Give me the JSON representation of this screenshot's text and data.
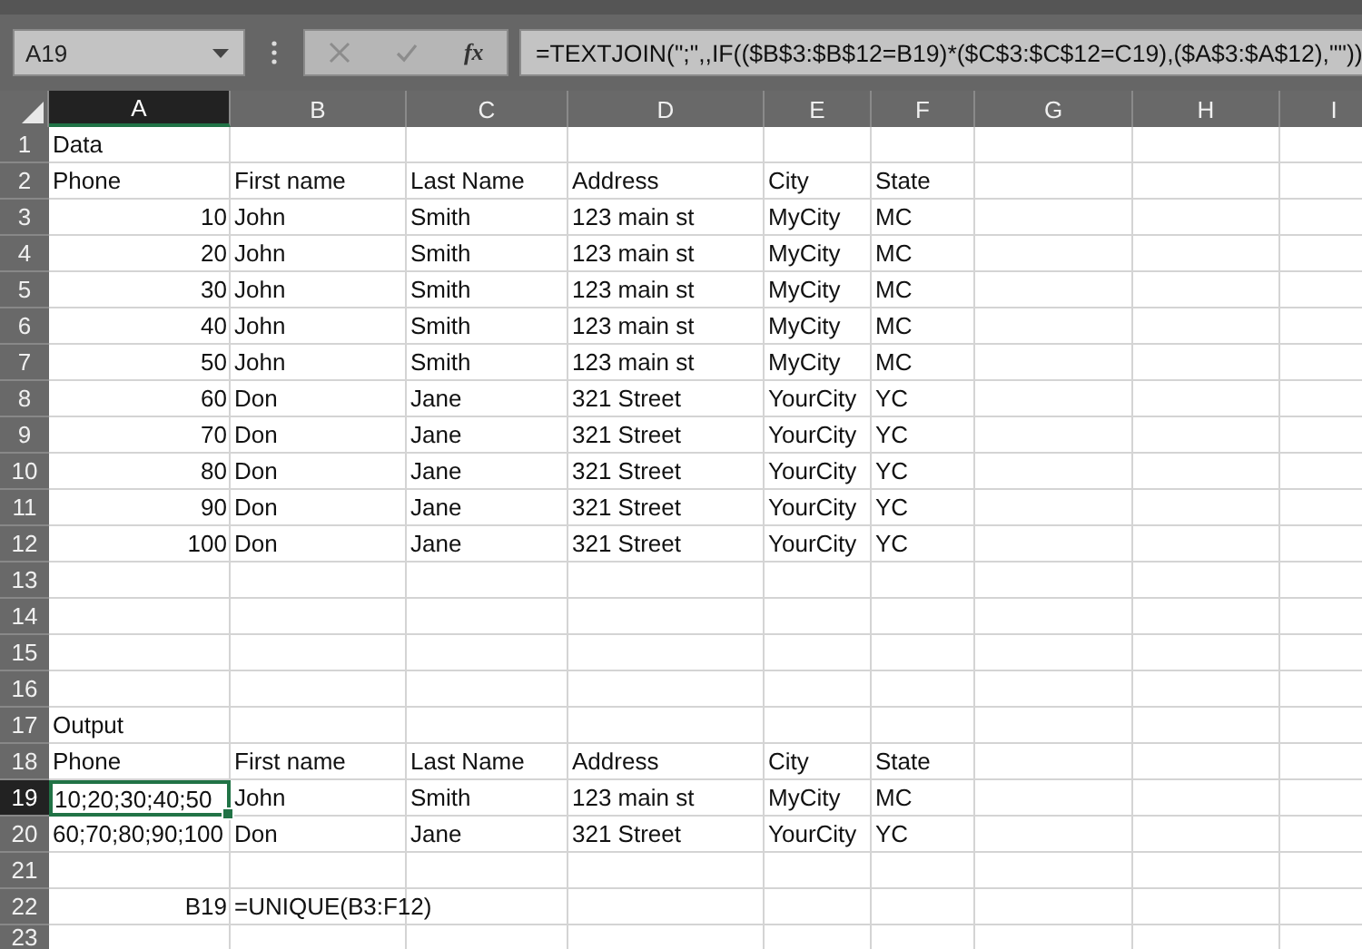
{
  "name_box": {
    "value": "A19"
  },
  "formula_bar": {
    "function_label": "fx",
    "formula": "=TEXTJOIN(\";\",,IF(($B$3:$B$12=B19)*($C$3:$C$12=C19),($A$3:$A$12),\"\"))"
  },
  "columns": [
    {
      "label": "A",
      "selected": true
    },
    {
      "label": "B",
      "selected": false
    },
    {
      "label": "C",
      "selected": false
    },
    {
      "label": "D",
      "selected": false
    },
    {
      "label": "E",
      "selected": false
    },
    {
      "label": "F",
      "selected": false
    },
    {
      "label": "G",
      "selected": false
    },
    {
      "label": "H",
      "selected": false
    },
    {
      "label": "I",
      "selected": false
    }
  ],
  "rows": [
    {
      "label": "1",
      "selected": false,
      "cells": [
        {
          "text": "Data",
          "kind": "text"
        }
      ]
    },
    {
      "label": "2",
      "selected": false,
      "cells": [
        {
          "text": "Phone",
          "kind": "text"
        },
        {
          "text": "First name",
          "kind": "text"
        },
        {
          "text": "Last Name",
          "kind": "text"
        },
        {
          "text": "Address",
          "kind": "text"
        },
        {
          "text": "City",
          "kind": "text"
        },
        {
          "text": "State",
          "kind": "text"
        }
      ]
    },
    {
      "label": "3",
      "selected": false,
      "cells": [
        {
          "text": "10",
          "kind": "number"
        },
        {
          "text": "John",
          "kind": "text"
        },
        {
          "text": "Smith",
          "kind": "text"
        },
        {
          "text": "123 main st",
          "kind": "text"
        },
        {
          "text": "MyCity",
          "kind": "text"
        },
        {
          "text": "MC",
          "kind": "text"
        }
      ]
    },
    {
      "label": "4",
      "selected": false,
      "cells": [
        {
          "text": "20",
          "kind": "number"
        },
        {
          "text": "John",
          "kind": "text"
        },
        {
          "text": "Smith",
          "kind": "text"
        },
        {
          "text": "123 main st",
          "kind": "text"
        },
        {
          "text": "MyCity",
          "kind": "text"
        },
        {
          "text": "MC",
          "kind": "text"
        }
      ]
    },
    {
      "label": "5",
      "selected": false,
      "cells": [
        {
          "text": "30",
          "kind": "number"
        },
        {
          "text": "John",
          "kind": "text"
        },
        {
          "text": "Smith",
          "kind": "text"
        },
        {
          "text": "123 main st",
          "kind": "text"
        },
        {
          "text": "MyCity",
          "kind": "text"
        },
        {
          "text": "MC",
          "kind": "text"
        }
      ]
    },
    {
      "label": "6",
      "selected": false,
      "cells": [
        {
          "text": "40",
          "kind": "number"
        },
        {
          "text": "John",
          "kind": "text"
        },
        {
          "text": "Smith",
          "kind": "text"
        },
        {
          "text": "123 main st",
          "kind": "text"
        },
        {
          "text": "MyCity",
          "kind": "text"
        },
        {
          "text": "MC",
          "kind": "text"
        }
      ]
    },
    {
      "label": "7",
      "selected": false,
      "cells": [
        {
          "text": "50",
          "kind": "number"
        },
        {
          "text": "John",
          "kind": "text"
        },
        {
          "text": "Smith",
          "kind": "text"
        },
        {
          "text": "123 main st",
          "kind": "text"
        },
        {
          "text": "MyCity",
          "kind": "text"
        },
        {
          "text": "MC",
          "kind": "text"
        }
      ]
    },
    {
      "label": "8",
      "selected": false,
      "cells": [
        {
          "text": "60",
          "kind": "number"
        },
        {
          "text": "Don",
          "kind": "text"
        },
        {
          "text": "Jane",
          "kind": "text"
        },
        {
          "text": "321 Street",
          "kind": "text"
        },
        {
          "text": "YourCity",
          "kind": "text"
        },
        {
          "text": "YC",
          "kind": "text"
        }
      ]
    },
    {
      "label": "9",
      "selected": false,
      "cells": [
        {
          "text": "70",
          "kind": "number"
        },
        {
          "text": "Don",
          "kind": "text"
        },
        {
          "text": "Jane",
          "kind": "text"
        },
        {
          "text": "321 Street",
          "kind": "text"
        },
        {
          "text": "YourCity",
          "kind": "text"
        },
        {
          "text": "YC",
          "kind": "text"
        }
      ]
    },
    {
      "label": "10",
      "selected": false,
      "cells": [
        {
          "text": "80",
          "kind": "number"
        },
        {
          "text": "Don",
          "kind": "text"
        },
        {
          "text": "Jane",
          "kind": "text"
        },
        {
          "text": "321 Street",
          "kind": "text"
        },
        {
          "text": "YourCity",
          "kind": "text"
        },
        {
          "text": "YC",
          "kind": "text"
        }
      ]
    },
    {
      "label": "11",
      "selected": false,
      "cells": [
        {
          "text": "90",
          "kind": "number"
        },
        {
          "text": "Don",
          "kind": "text"
        },
        {
          "text": "Jane",
          "kind": "text"
        },
        {
          "text": "321 Street",
          "kind": "text"
        },
        {
          "text": "YourCity",
          "kind": "text"
        },
        {
          "text": "YC",
          "kind": "text"
        }
      ]
    },
    {
      "label": "12",
      "selected": false,
      "cells": [
        {
          "text": "100",
          "kind": "number"
        },
        {
          "text": "Don",
          "kind": "text"
        },
        {
          "text": "Jane",
          "kind": "text"
        },
        {
          "text": "321 Street",
          "kind": "text"
        },
        {
          "text": "YourCity",
          "kind": "text"
        },
        {
          "text": "YC",
          "kind": "text"
        }
      ]
    },
    {
      "label": "13",
      "selected": false,
      "cells": []
    },
    {
      "label": "14",
      "selected": false,
      "cells": []
    },
    {
      "label": "15",
      "selected": false,
      "cells": []
    },
    {
      "label": "16",
      "selected": false,
      "cells": []
    },
    {
      "label": "17",
      "selected": false,
      "cells": [
        {
          "text": "Output",
          "kind": "text"
        }
      ]
    },
    {
      "label": "18",
      "selected": false,
      "cells": [
        {
          "text": "Phone",
          "kind": "text"
        },
        {
          "text": "First name",
          "kind": "text"
        },
        {
          "text": "Last Name",
          "kind": "text"
        },
        {
          "text": "Address",
          "kind": "text"
        },
        {
          "text": "City",
          "kind": "text"
        },
        {
          "text": "State",
          "kind": "text"
        }
      ]
    },
    {
      "label": "19",
      "selected": true,
      "cells": [
        {
          "text": "10;20;30;40;50",
          "kind": "text"
        },
        {
          "text": "John",
          "kind": "text"
        },
        {
          "text": "Smith",
          "kind": "text"
        },
        {
          "text": "123 main st",
          "kind": "text"
        },
        {
          "text": "MyCity",
          "kind": "text"
        },
        {
          "text": "MC",
          "kind": "text"
        }
      ]
    },
    {
      "label": "20",
      "selected": false,
      "cells": [
        {
          "text": "60;70;80;90;100",
          "kind": "text"
        },
        {
          "text": "Don",
          "kind": "text"
        },
        {
          "text": "Jane",
          "kind": "text"
        },
        {
          "text": "321 Street",
          "kind": "text"
        },
        {
          "text": "YourCity",
          "kind": "text"
        },
        {
          "text": "YC",
          "kind": "text"
        }
      ]
    },
    {
      "label": "21",
      "selected": false,
      "cells": []
    },
    {
      "label": "22",
      "selected": false,
      "cells": [
        {
          "text": "B19",
          "kind": "number"
        },
        {
          "text": "=UNIQUE(B3:F12)",
          "kind": "text"
        }
      ]
    },
    {
      "label": "23",
      "selected": false,
      "cells": []
    }
  ]
}
